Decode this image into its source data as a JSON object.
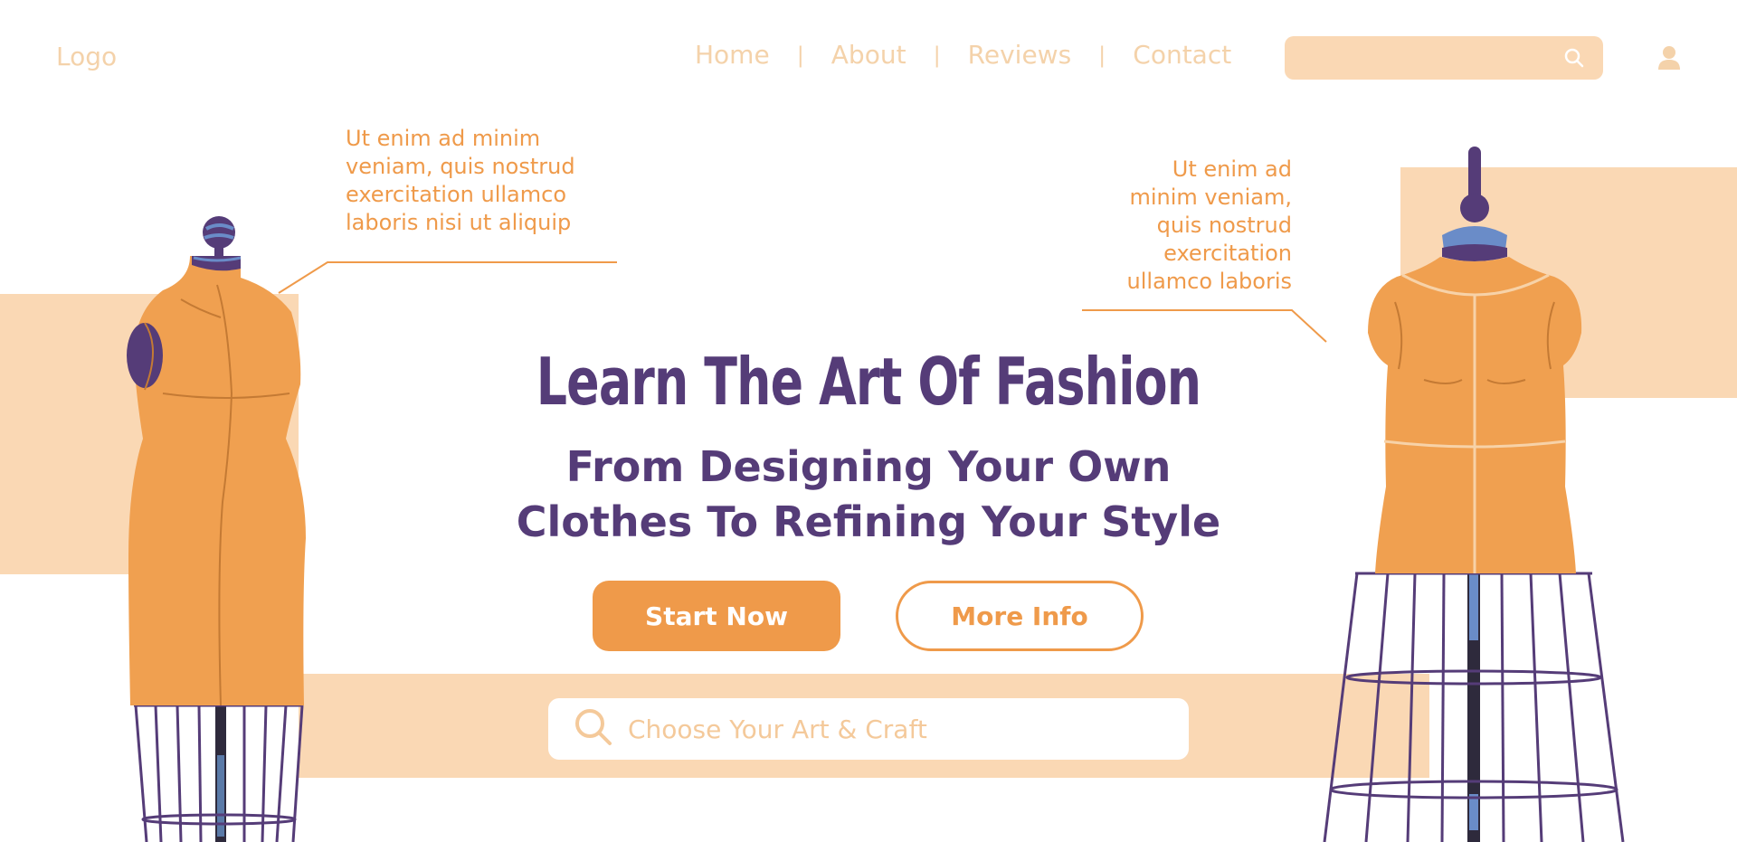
{
  "header": {
    "logo": "Logo",
    "nav": [
      {
        "label": "Home"
      },
      {
        "label": "About"
      },
      {
        "label": "Reviews"
      },
      {
        "label": "Contact"
      }
    ],
    "separator": "|",
    "search": {
      "placeholder": "",
      "icon": "search-icon"
    },
    "user_icon": "user-icon"
  },
  "callouts": {
    "left": [
      "Ut enim ad minim",
      "veniam, quis nostrud",
      "exercitation ullamco",
      "laboris nisi ut aliquip"
    ],
    "right": [
      "Ut enim ad",
      "minim veniam,",
      "quis nostrud",
      "exercitation",
      "ullamco laboris"
    ]
  },
  "hero": {
    "title": "Learn The Art Of Fashion",
    "subtitle_line1": "From Designing Your Own",
    "subtitle_line2": "Clothes To Refining Your Style",
    "start_button": "Start Now",
    "more_button": "More Info",
    "craft_search_placeholder": "Choose Your Art & Craft"
  },
  "colors": {
    "accent": "#ef9a4a",
    "accent_light": "#fad8b4",
    "text_primary": "#553c78",
    "mannequin_body": "#f0a050",
    "stand_frame": "#553c78"
  }
}
